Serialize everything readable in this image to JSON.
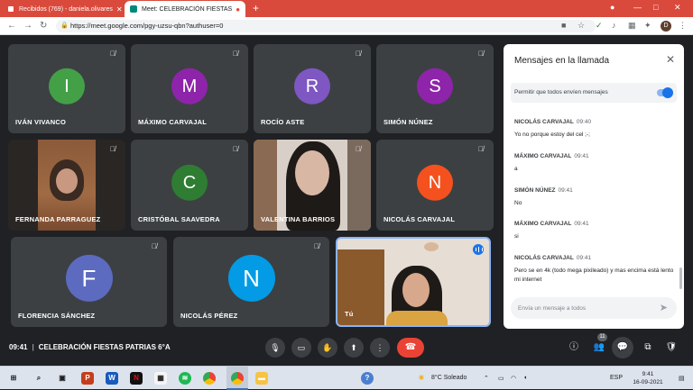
{
  "browser": {
    "tabs": [
      {
        "title": "Recibidos (769) - daniela.olivares",
        "color": "#ea4335"
      },
      {
        "title": "Meet: CELEBRACIÓN FIESTAS",
        "color": "#00897b"
      }
    ],
    "url": "https://meet.google.com/pgy-uzsu-qbn?authuser=0",
    "profile_initial": "D"
  },
  "participants": [
    {
      "name": "IVÁN VIVANCO",
      "initial": "I",
      "color": "#43a047"
    },
    {
      "name": "MÁXIMO CARVAJAL",
      "initial": "M",
      "color": "#8e24aa"
    },
    {
      "name": "ROCÍO ASTE",
      "initial": "R",
      "color": "#7e57c2"
    },
    {
      "name": "SIMÓN NÚNEZ",
      "initial": "S",
      "color": "#8e24aa"
    },
    {
      "name": "FERNANDA PARRAGUEZ",
      "initial": "",
      "color": ""
    },
    {
      "name": "CRISTÓBAL SAAVEDRA",
      "initial": "C",
      "color": "#2e7d32"
    },
    {
      "name": "VALENTINA BARRIOS",
      "initial": "",
      "color": ""
    },
    {
      "name": "NICOLÁS CARVAJAL",
      "initial": "N",
      "color": "#f4511e"
    },
    {
      "name": "FLORENCIA SÁNCHEZ",
      "initial": "F",
      "color": "#5c6bc0"
    },
    {
      "name": "NICOLÁS PÉREZ",
      "initial": "N",
      "color": "#039be5"
    },
    {
      "name": "Tú",
      "initial": "",
      "color": ""
    }
  ],
  "chat": {
    "title": "Mensajes en la llamada",
    "allow_label": "Permitir que todos envíen mensajes",
    "messages": [
      {
        "sender": "NICOLÁS CARVAJAL",
        "time": "09:40",
        "text": "Yo no porque estoy del cel ;-;"
      },
      {
        "sender": "MÁXIMO CARVAJAL",
        "time": "09:41",
        "text": "a"
      },
      {
        "sender": "SIMÓN NÚNEZ",
        "time": "09:41",
        "text": "No"
      },
      {
        "sender": "MÁXIMO CARVAJAL",
        "time": "09:41",
        "text": "si"
      },
      {
        "sender": "NICOLÁS CARVAJAL",
        "time": "09:41",
        "text": "Pero se en 4k (todo mega pixileado) y mas encima está lento mi internet"
      }
    ],
    "input_placeholder": "Envía un mensaje a todos"
  },
  "meeting": {
    "time": "09:41",
    "separator": "|",
    "name": "CELEBRACIÓN FIESTAS PATRIAS 6°A",
    "people_count": "11"
  },
  "taskbar": {
    "weather": "8°C Soleado",
    "language": "ESP",
    "clock_time": "9:41",
    "clock_date": "16-09-2021"
  }
}
